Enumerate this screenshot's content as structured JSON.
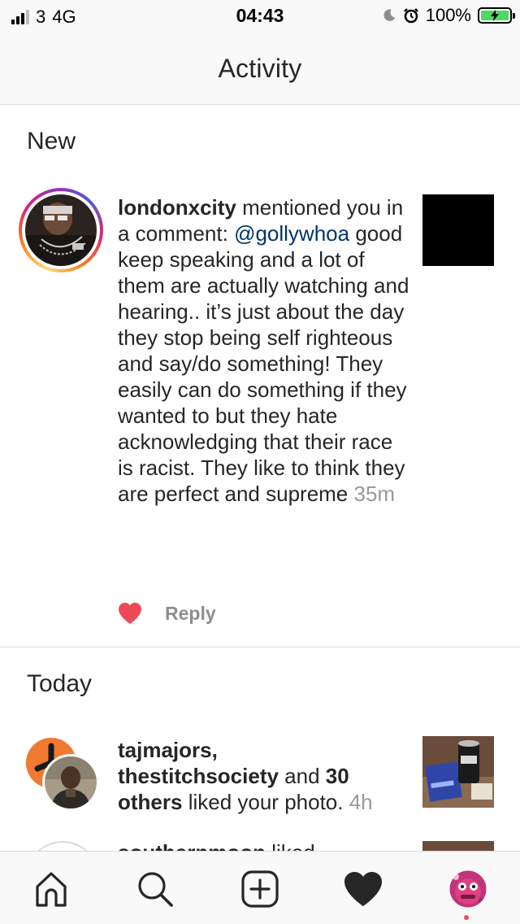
{
  "status_bar": {
    "carrier": "3",
    "network": "4G",
    "time": "04:43",
    "battery": "100%"
  },
  "header": {
    "title": "Activity"
  },
  "sections": {
    "new": "New",
    "today": "Today"
  },
  "new_notification": {
    "username": "londonxcity",
    "action": " mentioned you in a comment: ",
    "mention": "@gollywhoa",
    "comment": " good keep speaking and a lot of them are actually watching and hearing.. it’s just about the day they stop being self righteous and say/do something! They easily can do something if they wanted to but they hate acknowledging that their race is racist. They like to think they are perfect and supreme",
    "time": " 35m",
    "reply_label": "Reply"
  },
  "today_notification": {
    "user1": "tajmajors,",
    "user2": "thestitchsociety",
    "connector": " and ",
    "others": "30 others",
    "action": " liked your photo.",
    "time": " 4h"
  },
  "partial_notification": {
    "username": "southernmoon",
    "action": " liked"
  },
  "colors": {
    "like_red": "#ed4956",
    "mention_blue": "#003569",
    "battery_green": "#4cd964"
  },
  "tab_bar": [
    "home-icon",
    "search-icon",
    "add-post-icon",
    "activity-heart-icon",
    "profile-avatar"
  ]
}
